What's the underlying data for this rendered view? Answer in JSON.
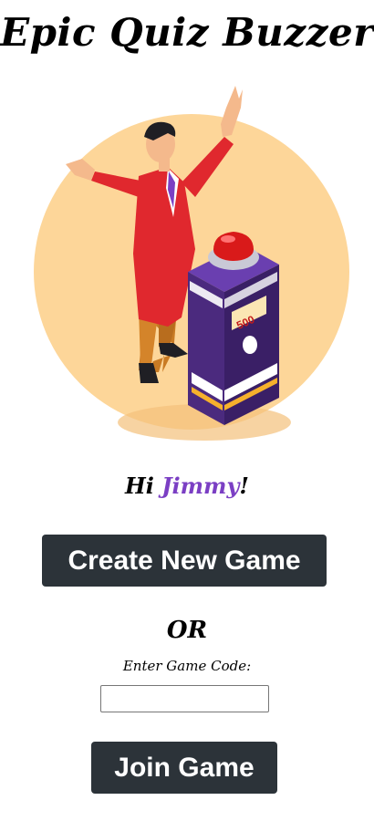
{
  "app": {
    "title": "Epic Quiz Buzzer"
  },
  "hero": {
    "image": "game-show-host-buzzer-illustration",
    "buzzer_score": "500",
    "colors": {
      "circle": "#fdd699",
      "jacket": "#e0282e",
      "podium": "#4b2a7e",
      "buzzer": "#d91a1a"
    }
  },
  "greeting": {
    "prefix": "Hi ",
    "name": "Jimmy",
    "suffix": "!",
    "name_color": "#7b3fc4"
  },
  "actions": {
    "create_label": "Create New Game",
    "or_label": "OR",
    "code_label": "Enter Game Code:",
    "code_value": "",
    "join_label": "Join Game"
  },
  "colors": {
    "button_bg": "#2c3339",
    "button_text": "#ffffff"
  }
}
